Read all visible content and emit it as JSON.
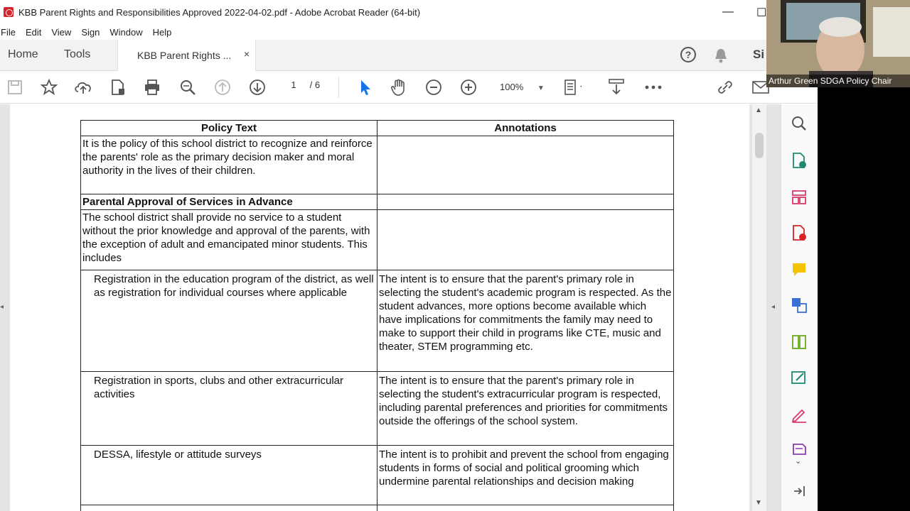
{
  "window": {
    "title": "KBB Parent Rights and Responsibilities Approved 2022-04-02.pdf - Adobe Acrobat Reader (64-bit)"
  },
  "menu": [
    "File",
    "Edit",
    "View",
    "Sign",
    "Window",
    "Help"
  ],
  "tabs": {
    "home": "Home",
    "tools": "Tools",
    "doc": "KBB Parent Rights ...",
    "close": "×"
  },
  "toolbar": {
    "page_current": "1",
    "page_total": "/ 6",
    "zoom": "100%"
  },
  "header_right": {
    "sign_partial": "Si"
  },
  "webcam": {
    "label": "Arthur Green  SDGA Policy Chair"
  },
  "document": {
    "headers": {
      "policy": "Policy Text",
      "annotations": "Annotations"
    },
    "rows": [
      {
        "policy": "It is the policy of this school district to recognize and reinforce the parents' role as the primary decision maker and moral authority in the lives of their children.",
        "annotation": ""
      },
      {
        "policy": "Parental Approval of Services in Advance",
        "annotation": ""
      },
      {
        "policy": "The school district shall provide no service to a student without the prior knowledge and approval of the parents, with the exception of adult and emancipated minor students.  This includes",
        "annotation": ""
      },
      {
        "policy": "Registration in the education program of the district, as well as registration for individual courses where applicable",
        "annotation": "The intent is to ensure that the parent's primary role in selecting the student's academic program is respected.  As the student advances, more options become available which have implications for commitments the family may need to make to support their child in programs like CTE, music and theater, STEM programming etc."
      },
      {
        "policy": "Registration in sports, clubs and other extracurricular activities",
        "annotation": "The intent is to ensure that the parent's primary role in selecting the student's extracurricular program is respected, including parental preferences and priorities for commitments outside the offerings of the school system."
      },
      {
        "policy": "DESSA, lifestyle or attitude surveys",
        "annotation": "The intent is to prohibit and prevent the school from engaging students in forms of social and political grooming which undermine parental relationships and decision making"
      }
    ]
  }
}
